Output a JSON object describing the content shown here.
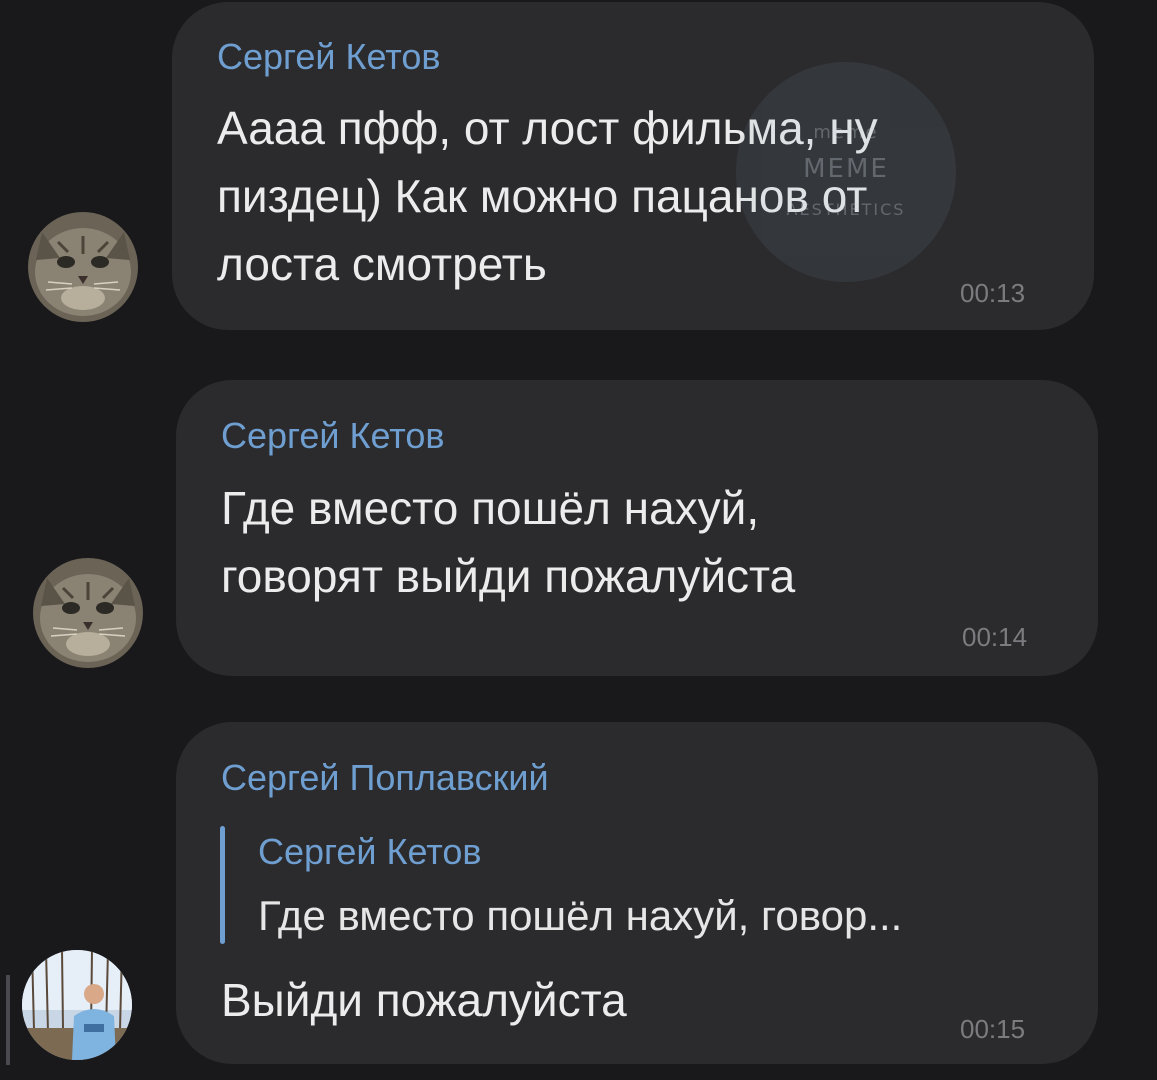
{
  "messages": [
    {
      "sender": "Сергей Кетов",
      "lines": [
        "Аааа пфф, от лост фильма, ну",
        "пиздец) Как можно пацанов от",
        "лоста смотреть"
      ],
      "time": "00:13",
      "avatar": "cat-avatar"
    },
    {
      "sender": "Сергей Кетов",
      "lines": [
        "Где вместо пошёл нахуй,",
        "говорят выйди пожалуйста"
      ],
      "time": "00:14",
      "avatar": "cat-avatar"
    },
    {
      "sender": "Сергей Поплавский",
      "reply": {
        "sender": "Сергей Кетов",
        "text": "Где вместо пошёл нахуй, говор..."
      },
      "lines": [
        "Выйди пожалуйста"
      ],
      "time": "00:15",
      "avatar": "person-avatar"
    }
  ],
  "watermark": {
    "line1": "meme",
    "line2": "MEME",
    "line3": "AESTHETICS"
  },
  "colors": {
    "background": "#19191b",
    "bubble": "#2b2b2e",
    "sender": "#6f9fd1",
    "text": "#ececec",
    "time": "#7c7c80"
  }
}
